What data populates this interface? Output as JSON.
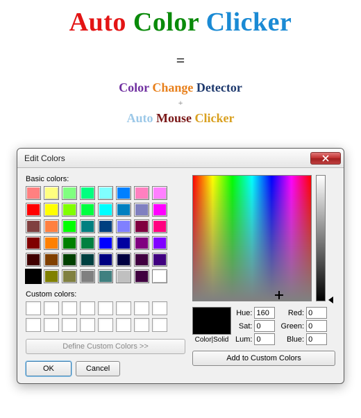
{
  "header": {
    "title_parts": [
      "Auto",
      "Color",
      "Clicker"
    ],
    "equals": "=",
    "line1_parts": [
      "Color",
      "Change",
      "Detector"
    ],
    "plus": "+",
    "line2_parts": [
      "Auto",
      "Mouse",
      "Clicker"
    ]
  },
  "dialog": {
    "title": "Edit Colors",
    "basic_label": "Basic colors:",
    "custom_label": "Custom colors:",
    "define_btn": "Define Custom Colors >>",
    "ok": "OK",
    "cancel": "Cancel",
    "color_solid": "Color|Solid",
    "hue_label": "Hue:",
    "sat_label": "Sat:",
    "lum_label": "Lum:",
    "red_label": "Red:",
    "green_label": "Green:",
    "blue_label": "Blue:",
    "hue": "160",
    "sat": "0",
    "lum": "0",
    "red": "0",
    "green": "0",
    "blue": "0",
    "add_custom": "Add to Custom Colors",
    "basic_colors": [
      "#ff8080",
      "#ffff80",
      "#80ff80",
      "#00ff80",
      "#80ffff",
      "#0080ff",
      "#ff80c0",
      "#ff80ff",
      "#ff0000",
      "#ffff00",
      "#80ff00",
      "#00ff40",
      "#00ffff",
      "#0080c0",
      "#8080c0",
      "#ff00ff",
      "#804040",
      "#ff8040",
      "#00ff00",
      "#008080",
      "#004080",
      "#8080ff",
      "#800040",
      "#ff0080",
      "#800000",
      "#ff8000",
      "#008000",
      "#008040",
      "#0000ff",
      "#0000a0",
      "#800080",
      "#8000ff",
      "#400000",
      "#804000",
      "#004000",
      "#004040",
      "#000080",
      "#000040",
      "#400040",
      "#400080",
      "#000000",
      "#808000",
      "#808040",
      "#808080",
      "#408080",
      "#c0c0c0",
      "#400040",
      "#ffffff"
    ],
    "selected_index": 40,
    "preview_color": "#000000"
  }
}
